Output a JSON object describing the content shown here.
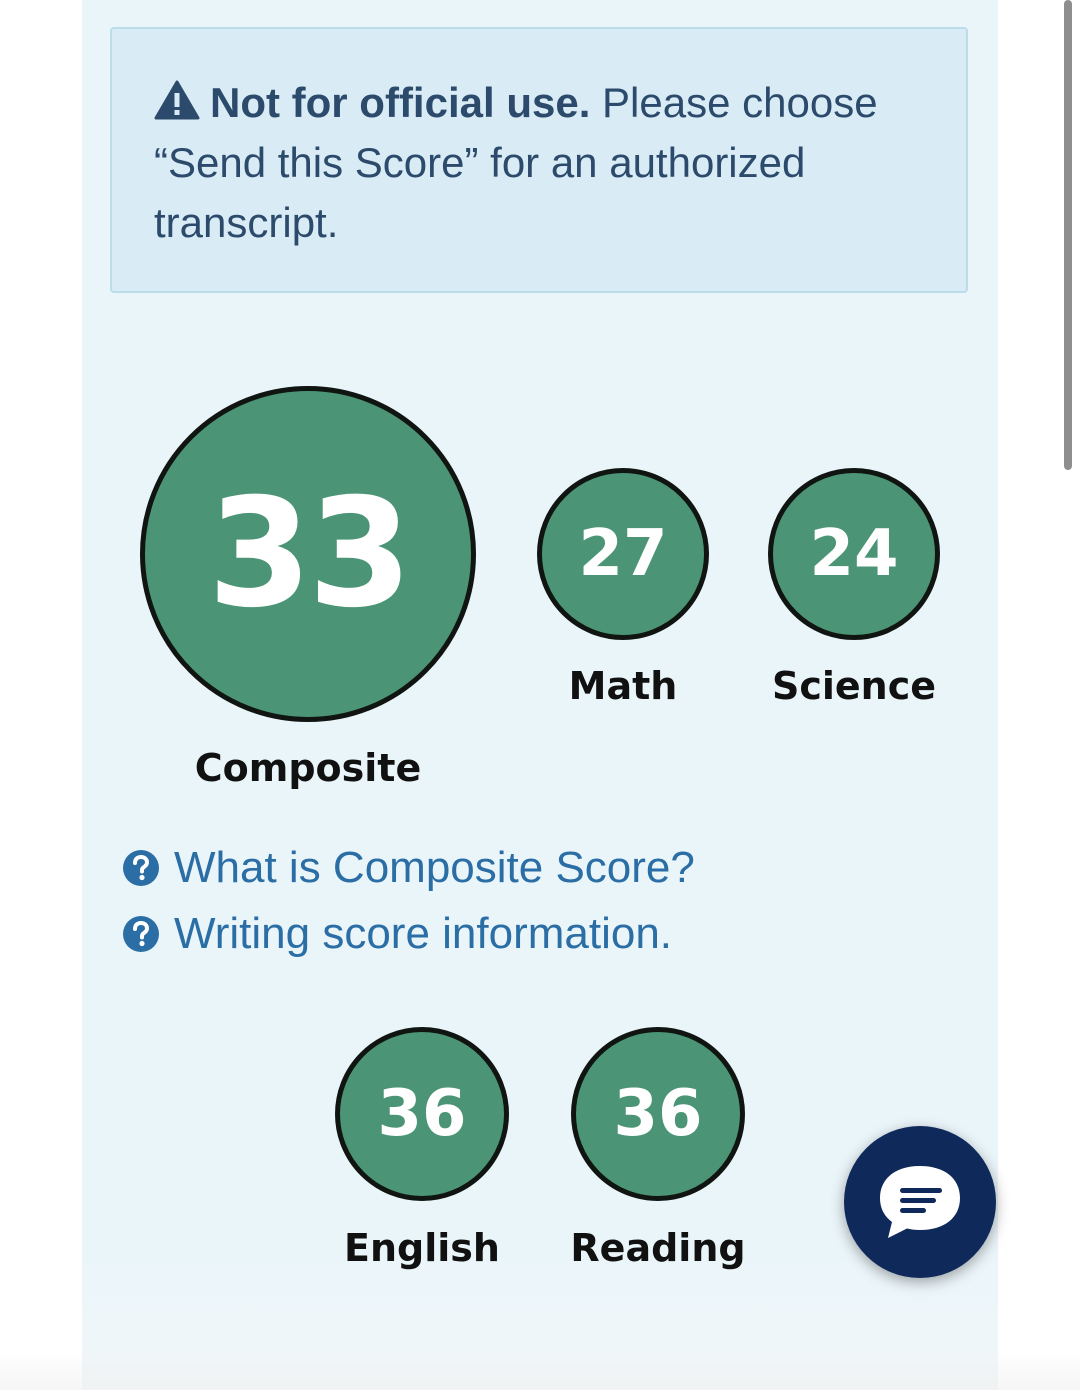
{
  "notice": {
    "bold_text": "Not for official use.",
    "body_text": "Please choose “Send this Score” for an authorized transcript."
  },
  "scores": {
    "composite": {
      "value": "33",
      "label": "Composite"
    },
    "math": {
      "value": "27",
      "label": "Math"
    },
    "science": {
      "value": "24",
      "label": "Science"
    },
    "english": {
      "value": "36",
      "label": "English"
    },
    "reading": {
      "value": "36",
      "label": "Reading"
    }
  },
  "links": {
    "composite_info": "What is Composite Score?",
    "writing_info": "Writing score information."
  },
  "icons": {
    "warning": "warning-icon",
    "help": "question-circle-icon",
    "chat": "chat-bubble-icon"
  },
  "colors": {
    "score_fill": "#4b9576",
    "score_border": "#101512",
    "notice_bg": "#d9ebf4",
    "link": "#2a6ea5",
    "chat_button": "#0f2a5a"
  }
}
